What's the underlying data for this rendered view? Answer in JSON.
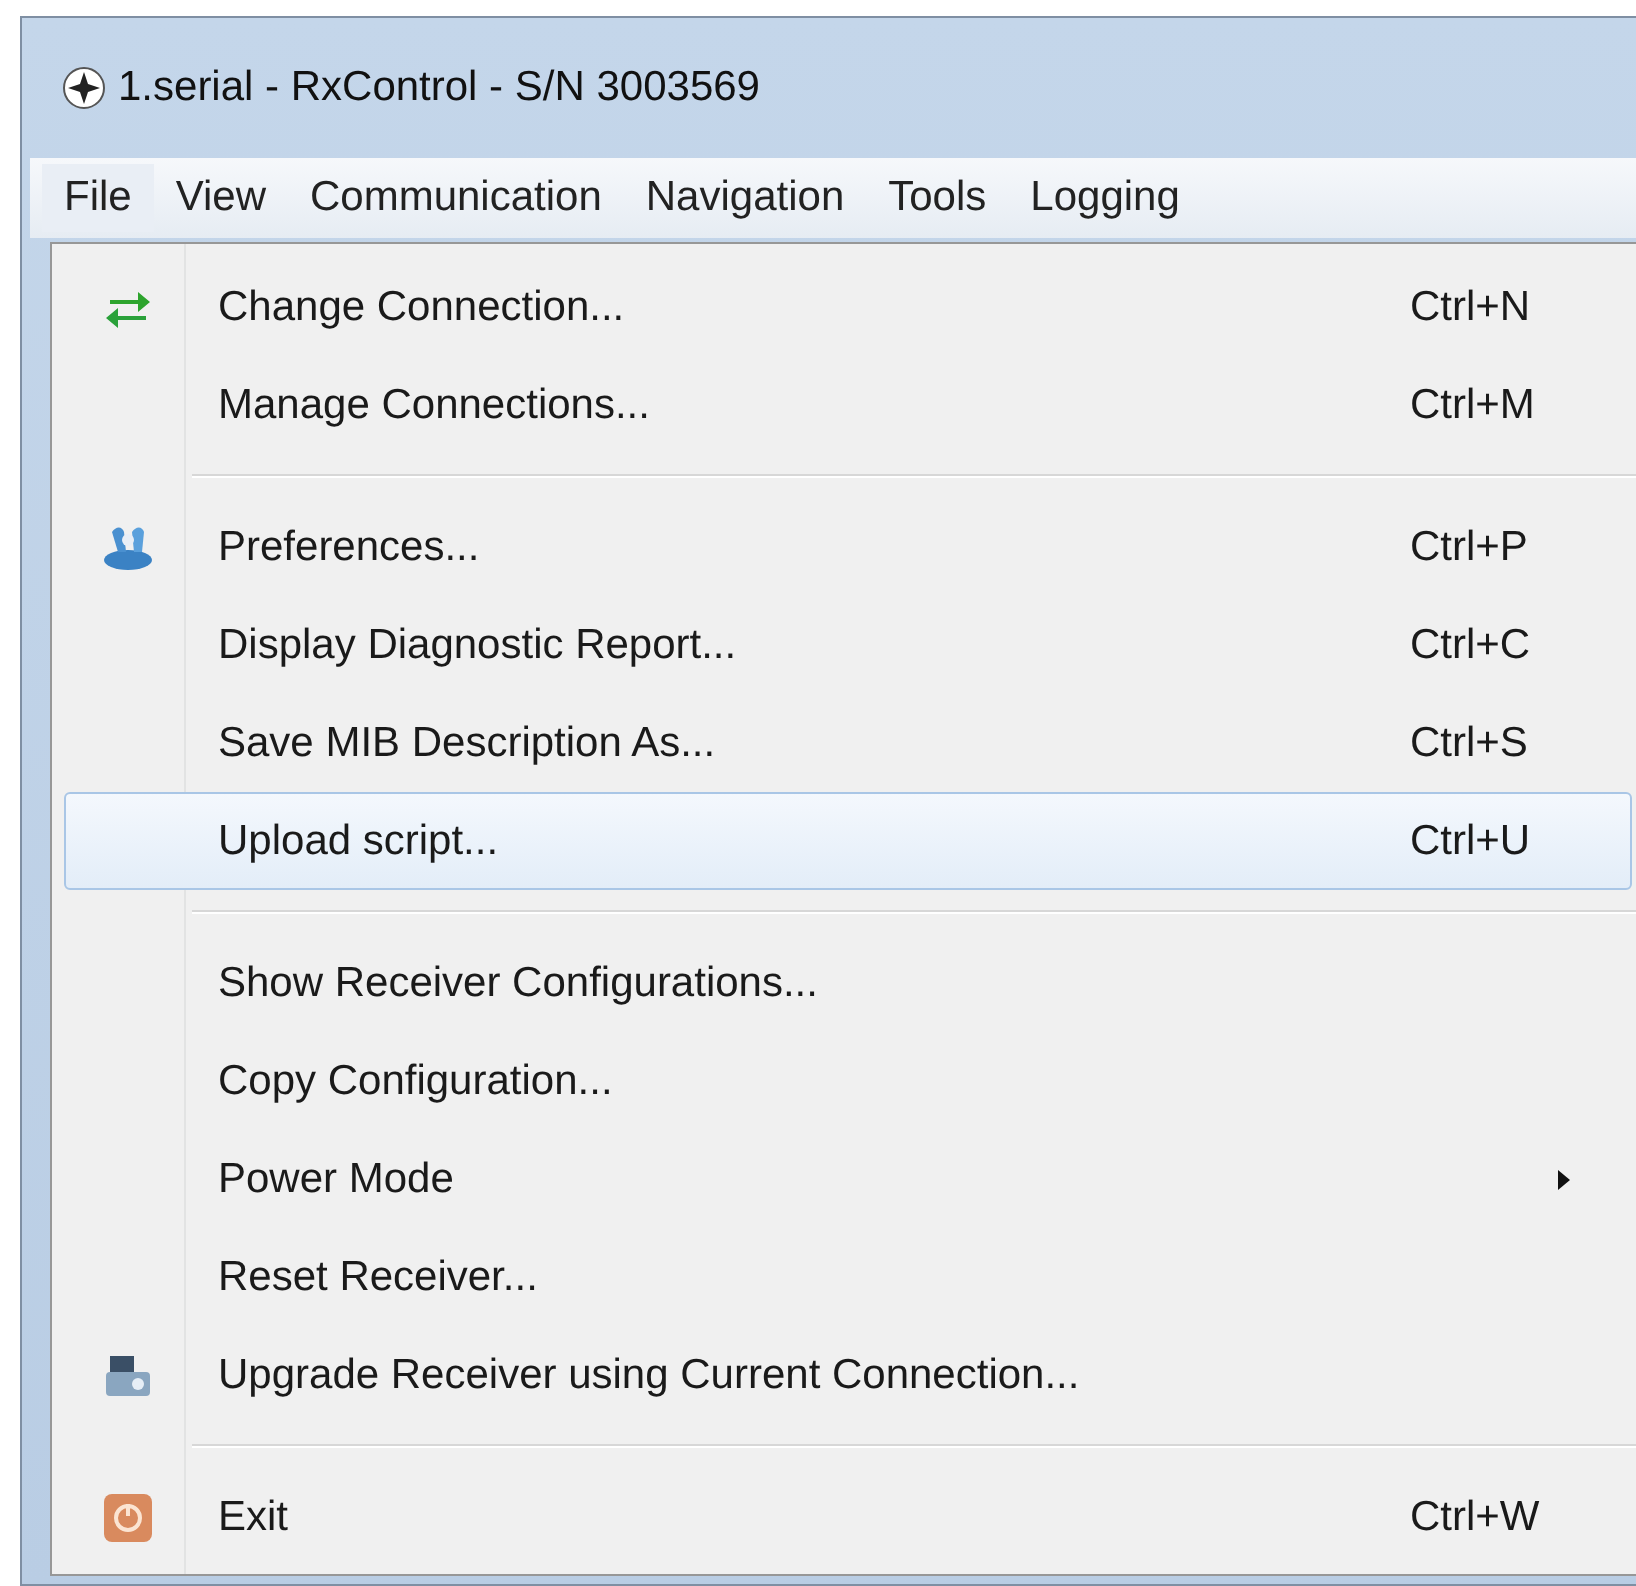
{
  "window": {
    "title": "1.serial - RxControl - S/N 3003569"
  },
  "menu_bar": [
    {
      "label": "File",
      "selected": true
    },
    {
      "label": "View",
      "selected": false
    },
    {
      "label": "Communication",
      "selected": false
    },
    {
      "label": "Navigation",
      "selected": false
    },
    {
      "label": "Tools",
      "selected": false
    },
    {
      "label": "Logging",
      "selected": false
    }
  ],
  "file_menu": {
    "groups": [
      [
        {
          "label": "Change Connection...",
          "shortcut": "Ctrl+N",
          "selected": false,
          "submenu": false
        },
        {
          "label": "Manage Connections...",
          "shortcut": "Ctrl+M",
          "selected": false,
          "submenu": false
        }
      ],
      [
        {
          "label": "Preferences...",
          "shortcut": "Ctrl+P",
          "selected": false,
          "submenu": false
        },
        {
          "label": "Display Diagnostic Report...",
          "shortcut": "Ctrl+C",
          "selected": false,
          "submenu": false
        },
        {
          "label": "Save MIB Description As...",
          "shortcut": "Ctrl+S",
          "selected": false,
          "submenu": false
        },
        {
          "label": "Upload script...",
          "shortcut": "Ctrl+U",
          "selected": true,
          "submenu": false
        }
      ],
      [
        {
          "label": "Show Receiver Configurations...",
          "selected": false,
          "submenu": false
        },
        {
          "label": "Copy Configuration...",
          "selected": false,
          "submenu": false
        },
        {
          "label": "Power Mode",
          "selected": false,
          "submenu": true
        },
        {
          "label": "Reset Receiver...",
          "selected": false,
          "submenu": false
        },
        {
          "label": "Upgrade Receiver using Current Connection...",
          "selected": false,
          "submenu": false
        }
      ],
      [
        {
          "label": "Exit",
          "shortcut": "Ctrl+W",
          "selected": false,
          "submenu": false
        }
      ]
    ]
  }
}
